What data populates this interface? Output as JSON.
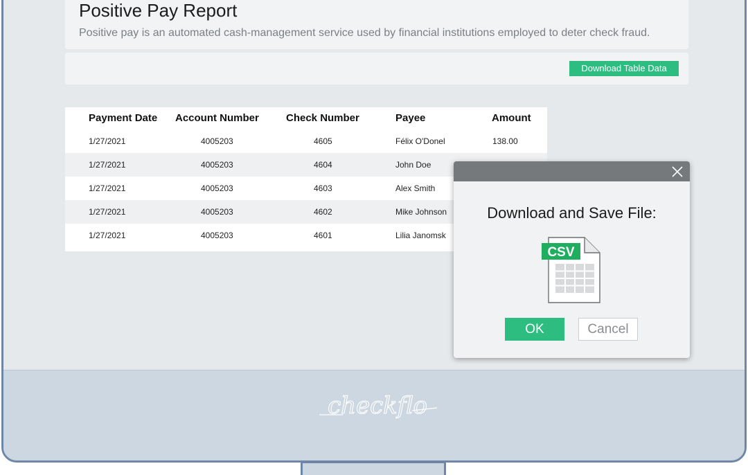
{
  "header": {
    "title": "Positive Pay Report",
    "subtitle": "Positive pay is an automated cash-management service used by financial institutions employed to deter check fraud."
  },
  "toolbar": {
    "download_label": "Download Table Data"
  },
  "table": {
    "columns": [
      "Payment Date",
      "Account Number",
      "Check Number",
      "Payee",
      "Amount"
    ],
    "rows": [
      [
        "1/27/2021",
        "4005203",
        "4605",
        "Félix O'Donel",
        "138.00"
      ],
      [
        "1/27/2021",
        "4005203",
        "4604",
        "John Doe",
        ""
      ],
      [
        "1/27/2021",
        "4005203",
        "4603",
        "Alex Smith",
        ""
      ],
      [
        "1/27/2021",
        "4005203",
        "4602",
        "Mike Johnson",
        ""
      ],
      [
        "1/27/2021",
        "4005203",
        "4601",
        "Lilia Janomsk",
        ""
      ]
    ]
  },
  "dialog": {
    "title": "Download and Save File:",
    "file_badge": "CSV",
    "ok_label": "OK",
    "cancel_label": "Cancel",
    "close_icon": "close-icon",
    "file_icon": "csv-file-icon"
  },
  "brand": {
    "name": "checkflo"
  },
  "colors": {
    "accent": "#2ebd80",
    "frame": "#6f87a6",
    "bezel": "#cdd7e1",
    "dialog_bar": "#76797c"
  }
}
